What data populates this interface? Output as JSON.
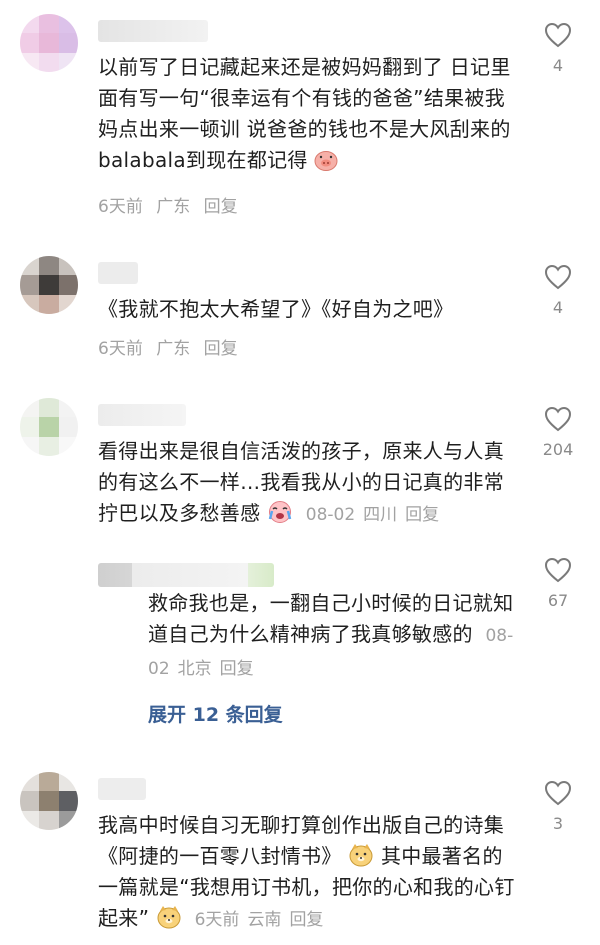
{
  "comments": [
    {
      "text": "以前写了日记藏起来还是被妈妈翻到了 日记里面有写一句“很幸运有个有钱的爸爸”结果被我妈点出来一顿训 说爸爸的钱也不是大风刮来的balabala到现在都记得",
      "emoji": "pig-emoji",
      "time": "6天前",
      "location": "广东",
      "reply_label": "回复",
      "likes": "4"
    },
    {
      "text": "《我就不抱太大希望了》《好自为之吧》",
      "time": "6天前",
      "location": "广东",
      "reply_label": "回复",
      "likes": "4"
    },
    {
      "text": "看得出来是很自信活泼的孩子，原来人与人真的有这么不一样…我看我从小的日记真的非常拧巴以及多愁善感",
      "emoji": "crying-emoji",
      "time": "08-02",
      "location": "四川",
      "reply_label": "回复",
      "likes": "204",
      "reply": {
        "text": "救命我也是，一翻自己小时候的日记就知道自己为什么精神病了我真够敏感的",
        "time": "08-02",
        "location": "北京",
        "reply_label": "回复",
        "likes": "67"
      },
      "expand_label": "展开 12 条回复"
    },
    {
      "text": "我高中时候自习无聊打算创作出版自己的诗集《阿捷的一百零八封情书》",
      "text_after": "其中最著名的一篇就是“我想用订书机，把你的心和我的心钉起来”",
      "emoji": "doge-emoji",
      "time": "6天前",
      "location": "云南",
      "reply_label": "回复",
      "likes": "3"
    }
  ],
  "colors": {
    "text": "#1f1f1f",
    "meta": "#a2a2a2",
    "expand": "#3a5f94",
    "heart": "#7a7a7a"
  }
}
